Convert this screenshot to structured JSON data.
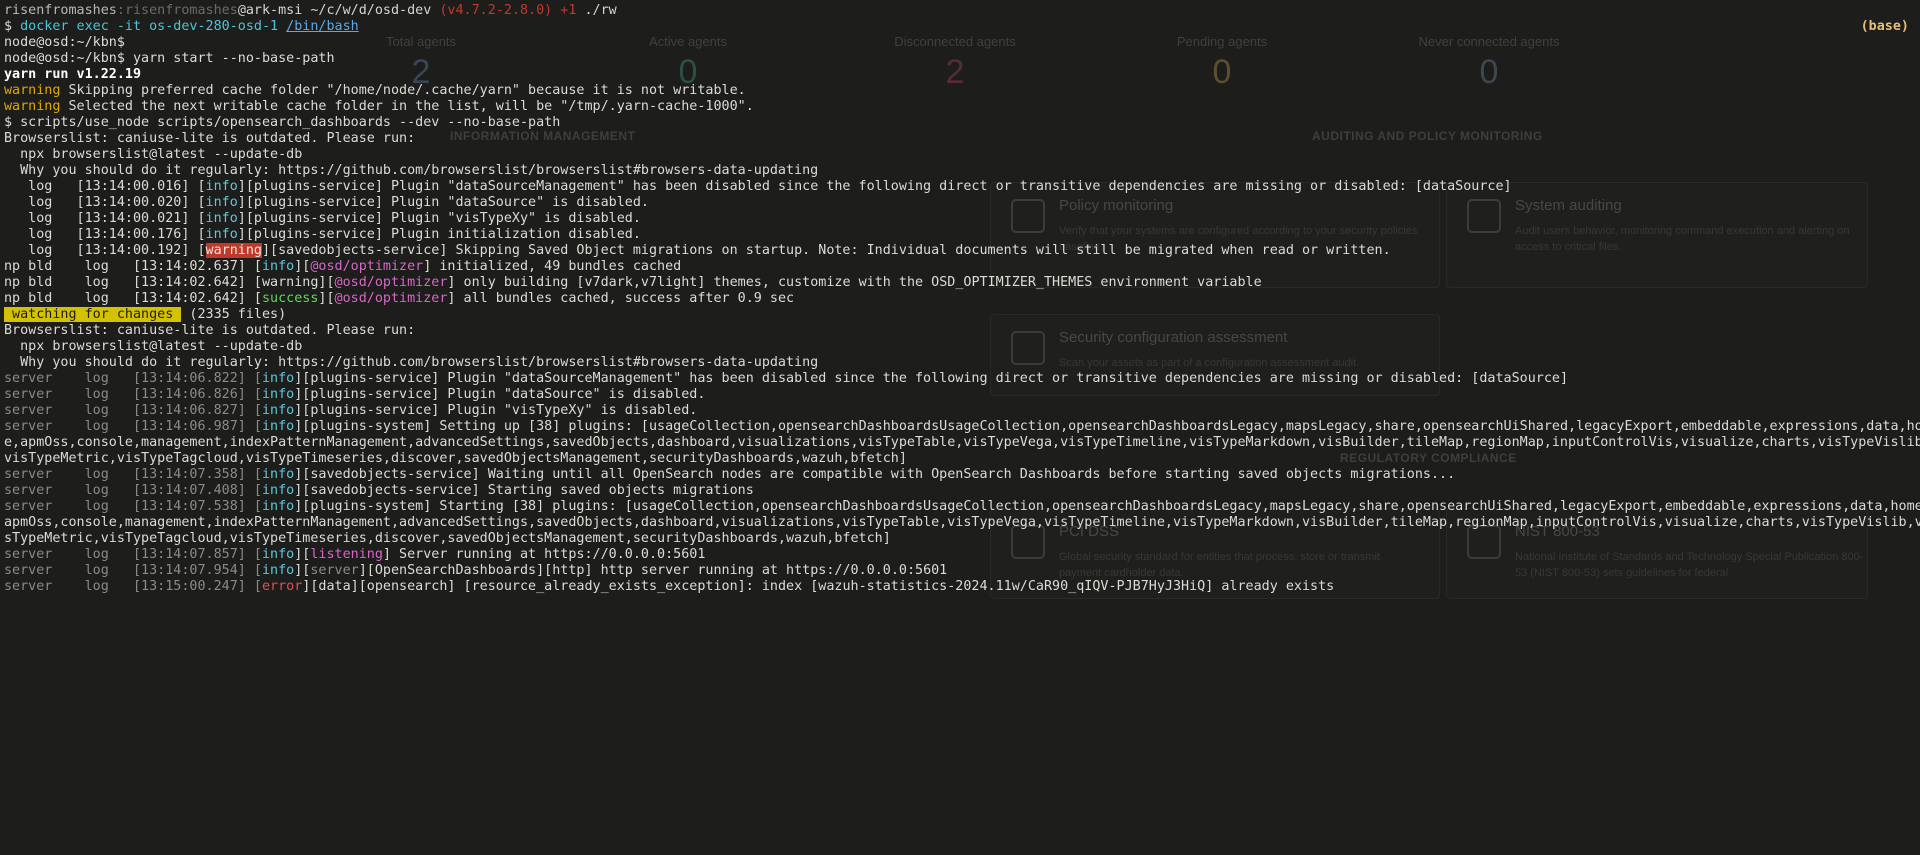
{
  "terminal": {
    "prompt": {
      "user": "risenfromashes",
      "sep": ":",
      "host_dim": "risenfromashes",
      "at_host": "@ark-msi",
      "cwd": " ~/c/w/d/osd-dev ",
      "git": "(v4.7.2-2.8.0) +1",
      "cmd": " ./rw"
    },
    "docker_cmd": {
      "dollar": "$ ",
      "cmd": "docker exec -it os-dev-280-osd-1 ",
      "shell": "/bin/bash"
    },
    "base_tag": "(base)",
    "lines": {
      "l3": "node@osd:~/kbn$",
      "l4": "node@osd:~/kbn$ yarn start --no-base-path",
      "l5": "yarn run v1.22.19",
      "l6a": "warning",
      "l6b": " Skipping preferred cache folder \"/home/node/.cache/yarn\" because it is not writable.",
      "l7a": "warning",
      "l7b": " Selected the next writable cache folder in the list, will be \"/tmp/.yarn-cache-1000\".",
      "l8": "$ scripts/use_node scripts/opensearch_dashboards --dev --no-base-path",
      "l9": "Browserslist: caniuse-lite is outdated. Please run:",
      "l10": "  npx browserslist@latest --update-db",
      "l11": "  Why you should do it regularly: https://github.com/browserslist/browserslist#browsers-data-updating",
      "l12a": "   log   [13:14:00.016] [",
      "l12b": "info",
      "l12c": "][plugins-service] Plugin \"dataSourceManagement\" has been disabled since the following direct or transitive dependencies are missing or disabled: [dataSource]",
      "l13a": "   log   [13:14:00.020] [",
      "l13b": "info",
      "l13c": "][plugins-service] Plugin \"dataSource\" is disabled.",
      "l14a": "   log   [13:14:00.021] [",
      "l14b": "info",
      "l14c": "][plugins-service] Plugin \"visTypeXy\" is disabled.",
      "l15a": "   log   [13:14:00.176] [",
      "l15b": "info",
      "l15c": "][plugins-service] Plugin initialization disabled.",
      "l16a": "   log   [13:14:00.192] [",
      "l16b": "warning",
      "l16c": "][savedobjects-service] Skipping Saved Object migrations on startup. Note: Individual documents will still be migrated when read or written.",
      "l17a": "np bld    log   [13:14:02.637] [",
      "l17b": "info",
      "l17c": "][",
      "l17d": "@osd/optimizer",
      "l17e": "] initialized, 49 bundles cached",
      "l18a": "np bld    log   [13:14:02.642] [warning][",
      "l18b": "@osd/optimizer",
      "l18c": "] only building [v7dark,v7light] themes, customize with the OSD_OPTIMIZER_THEMES environment variable",
      "l19a": "np bld    log   [13:14:02.642] [",
      "l19b": "success",
      "l19c": "][",
      "l19d": "@osd/optimizer",
      "l19e": "] all bundles cached, success after 0.9 sec",
      "l20a": " watching for changes ",
      "l20b": " (2335 files)",
      "l21": "Browserslist: caniuse-lite is outdated. Please run:",
      "l22": "  npx browserslist@latest --update-db",
      "l23": "  Why you should do it regularly: https://github.com/browserslist/browserslist#browsers-data-updating",
      "s1a": "server    log   [13:14:06.822] [",
      "s1b": "info",
      "s1c": "][plugins-service] Plugin \"dataSourceManagement\" has been disabled since the following direct or transitive dependencies are missing or disabled: [dataSource]",
      "s2a": "server    log   [13:14:06.826] [",
      "s2b": "info",
      "s2c": "][plugins-service] Plugin \"dataSource\" is disabled.",
      "s3a": "server    log   [13:14:06.827] [",
      "s3b": "info",
      "s3c": "][plugins-service] Plugin \"visTypeXy\" is disabled.",
      "s4a": "server    log   [13:14:06.987] [",
      "s4b": "info",
      "s4c": "][plugins-system] Setting up [38] plugins: [usageCollection,opensearchDashboardsUsageCollection,opensearchDashboardsLegacy,mapsLegacy,share,opensearchUiShared,legacyExport,embeddable,expressions,data,hom",
      "s4d": "e,apmOss,console,management,indexPatternManagement,advancedSettings,savedObjects,dashboard,visualizations,visTypeTable,visTypeVega,visTypeTimeline,visTypeMarkdown,visBuilder,tileMap,regionMap,inputControlVis,visualize,charts,visTypeVislib,",
      "s4e": "visTypeMetric,visTypeTagcloud,visTypeTimeseries,discover,savedObjectsManagement,securityDashboards,wazuh,bfetch]",
      "s5a": "server    log   [13:14:07.358] [",
      "s5b": "info",
      "s5c": "][savedobjects-service] Waiting until all OpenSearch nodes are compatible with OpenSearch Dashboards before starting saved objects migrations...",
      "s6a": "server    log   [13:14:07.408] [",
      "s6b": "info",
      "s6c": "][savedobjects-service] Starting saved objects migrations",
      "s7a": "server    log   [13:14:07.538] [",
      "s7b": "info",
      "s7c": "][plugins-system] Starting [38] plugins: [usageCollection,opensearchDashboardsUsageCollection,opensearchDashboardsLegacy,mapsLegacy,share,opensearchUiShared,legacyExport,embeddable,expressions,data,home,",
      "s7d": "apmOss,console,management,indexPatternManagement,advancedSettings,savedObjects,dashboard,visualizations,visTypeTable,visTypeVega,visTypeTimeline,visTypeMarkdown,visBuilder,tileMap,regionMap,inputControlVis,visualize,charts,visTypeVislib,vi",
      "s7e": "sTypeMetric,visTypeTagcloud,visTypeTimeseries,discover,savedObjectsManagement,securityDashboards,wazuh,bfetch]",
      "s8a": "server    log   [13:14:07.857] [",
      "s8b": "info",
      "s8c": "][",
      "s8d": "listening",
      "s8e": "] Server running at https://0.0.0.0:5601",
      "s9a": "server    log   [13:14:07.954] [",
      "s9b": "info",
      "s9c": "][",
      "s9d": "server",
      "s9e": "][OpenSearchDashboards][http] http server running at https://0.0.0.0:5601",
      "s10a": "server    log   [13:15:00.247] [",
      "s10b": "error",
      "s10c": "][data][opensearch] [resource_already_exists_exception]: index [wazuh-statistics-2024.11w/CaR90_qIQV-PJB7HyJ3HiQ] already exists"
    }
  },
  "ghost_dashboard": {
    "stats": [
      {
        "label": "Total agents",
        "value": "2",
        "color": "#4a6a8a"
      },
      {
        "label": "Active agents",
        "value": "0",
        "color": "#3a7a6a"
      },
      {
        "label": "Disconnected agents",
        "value": "2",
        "color": "#8a3a4a"
      },
      {
        "label": "Pending agents",
        "value": "0",
        "color": "#8a7a3a"
      },
      {
        "label": "Never connected agents",
        "value": "0",
        "color": "#5a6a7a"
      }
    ],
    "headings": {
      "info_mgmt": "INFORMATION MANAGEMENT",
      "audit": "AUDITING AND POLICY MONITORING",
      "regulatory": "REGULATORY COMPLIANCE"
    },
    "cards": {
      "policy_title": "Policy monitoring",
      "policy_desc": "Verify that your systems are configured according to your security policies baseline.",
      "audit_title": "System auditing",
      "audit_desc": "Audit users behavior, monitoring command execution and alerting on access to critical files.",
      "sca_title": "Security configuration assessment",
      "sca_desc": "Scan your assets as part of a configuration assessment audit.",
      "pci_title": "PCI DSS",
      "pci_desc": "Global security standard for entities that process, store or transmit payment cardholder data.",
      "nist_title": "NIST 800-53",
      "nist_desc": "National Institute of Standards and Technology Special Publication 800-53 (NIST 800-53) sets guidelines for federal"
    }
  }
}
